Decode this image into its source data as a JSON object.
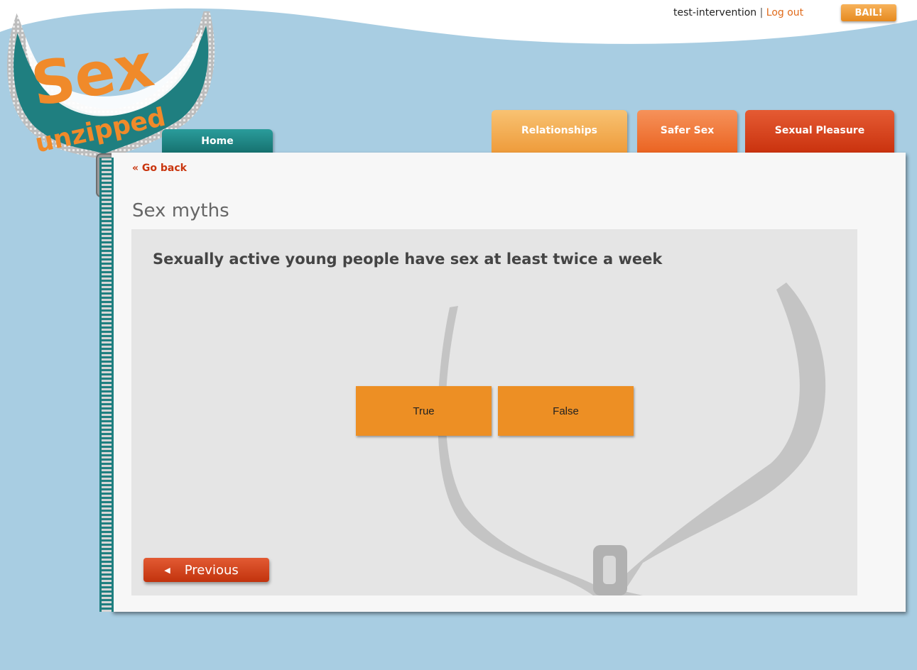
{
  "header": {
    "username": "test-intervention",
    "separator": "|",
    "logout_label": "Log out",
    "bail_label": "BAIL!"
  },
  "logo": {
    "line1": "Sex",
    "line2": "unzipped",
    "colors": {
      "orange": "#f08a2a",
      "teal": "#1f7f80"
    }
  },
  "nav": {
    "home": "Home",
    "relationships": "Relationships",
    "safer_sex": "Safer Sex",
    "sexual_pleasure": "Sexual Pleasure"
  },
  "page": {
    "back_label": "« Go back",
    "title": "Sex myths"
  },
  "quiz": {
    "question": "Sexually active young people have sex at least twice a week",
    "answers": [
      "True",
      "False"
    ],
    "previous_label": "Previous",
    "previous_icon": "triangle-left-icon"
  },
  "colors": {
    "background": "#a8cde2",
    "accent_orange": "#ed8f24",
    "accent_red": "#c9350e",
    "teal": "#1f7f80"
  }
}
